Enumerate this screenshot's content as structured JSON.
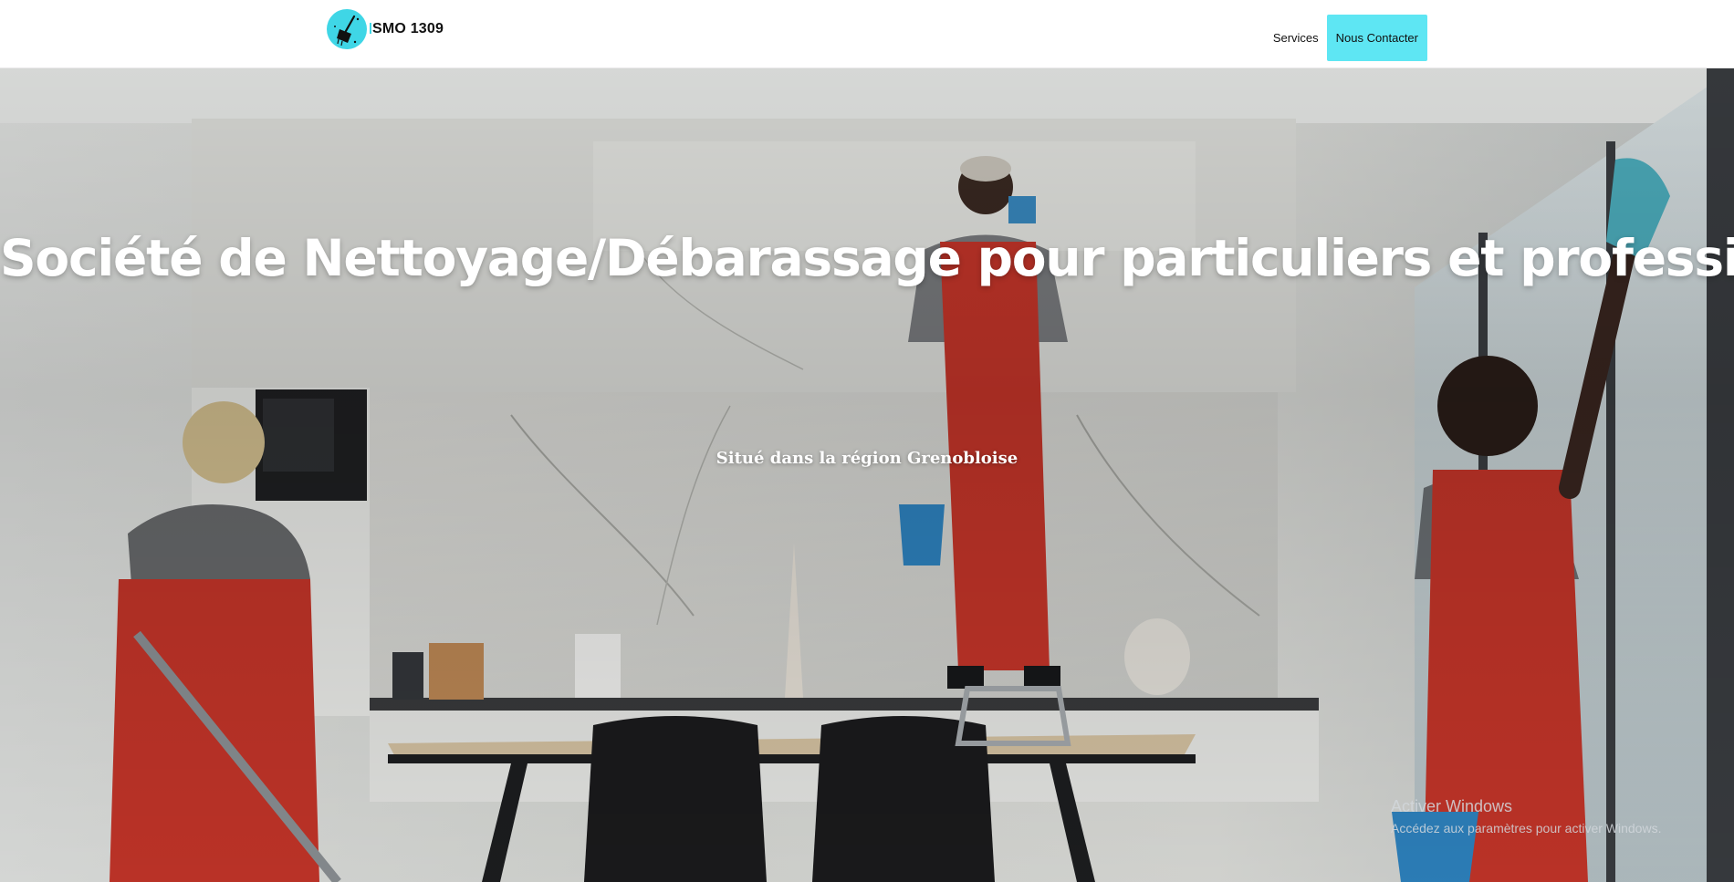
{
  "brand": {
    "name": "SMO 1309",
    "logo_icon": "broom-icon",
    "accent_color": "#3fd6e6"
  },
  "nav": {
    "services_label": "Services",
    "contact_label": "Nous Contacter",
    "contact_bg": "#5ee6f3"
  },
  "hero": {
    "title": "Société de Nettoyage/Débarassage pour particuliers et professionels",
    "subtitle": "Situé dans la région Grenobloise"
  },
  "watermark": {
    "line1": "Activer Windows",
    "line2": "Accédez aux paramètres pour activer Windows."
  }
}
